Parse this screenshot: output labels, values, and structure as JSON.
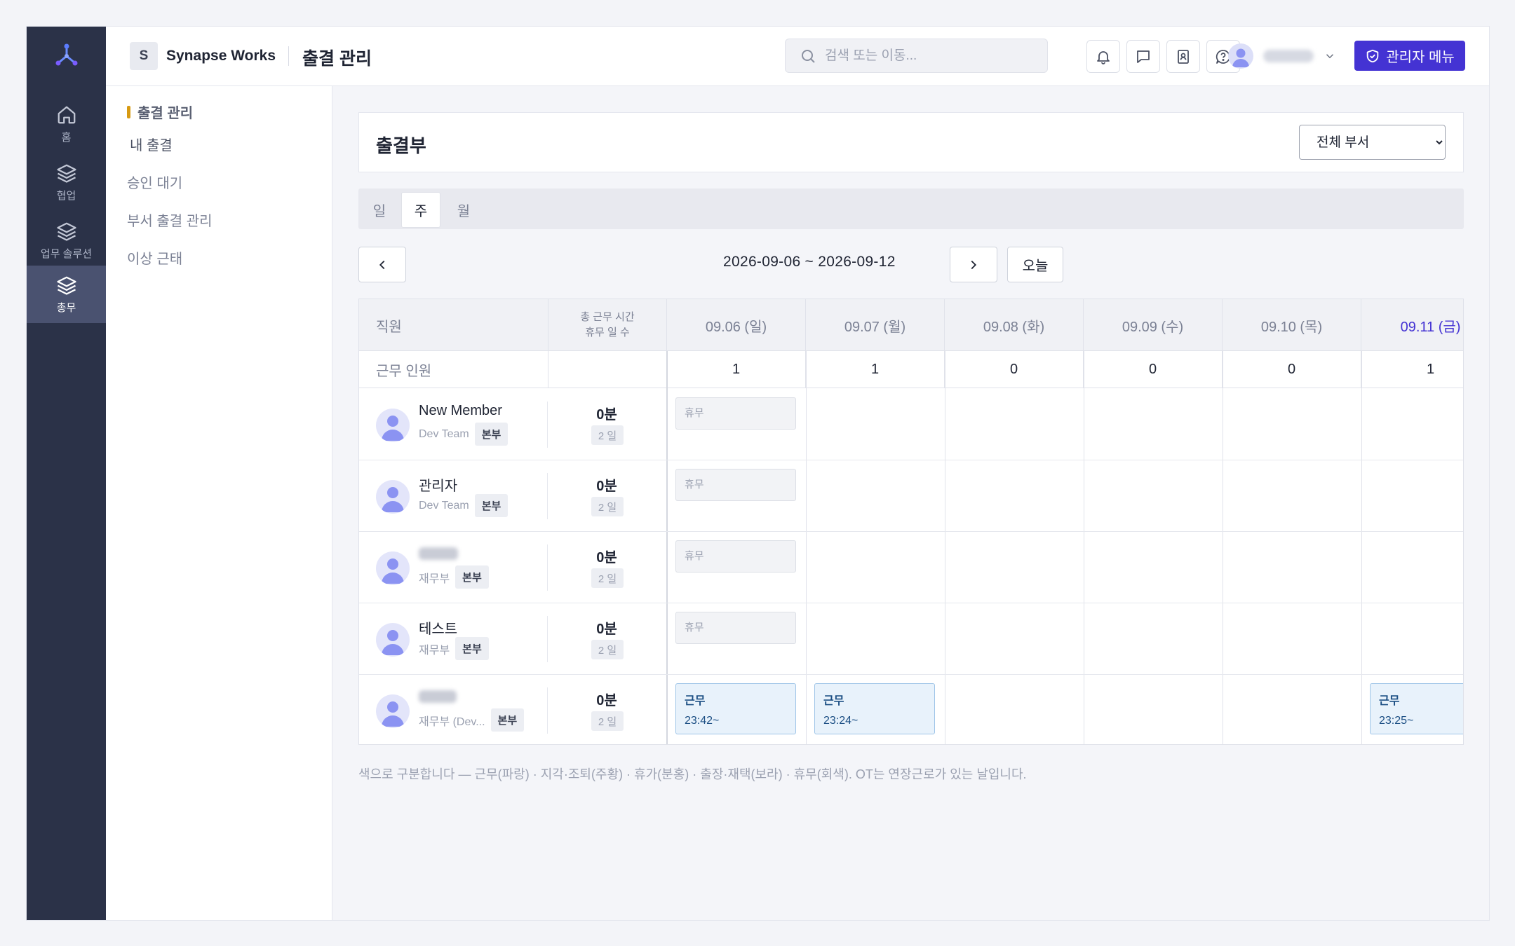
{
  "rail": {
    "items": [
      {
        "label": "홈",
        "icon": "home-icon"
      },
      {
        "label": "협업",
        "icon": "layers-icon"
      },
      {
        "label": "업무 솔루션",
        "icon": "layers-icon"
      },
      {
        "label": "총무",
        "icon": "layers-icon",
        "active": true
      }
    ]
  },
  "topbar": {
    "brand_initial": "S",
    "brand_name": "Synapse Works",
    "page_title": "출결 관리",
    "search_placeholder": "검색 또는 이동...",
    "admin_label": "관리자 메뉴",
    "icons": [
      "bell-icon",
      "chat-icon",
      "contacts-icon",
      "help-icon"
    ]
  },
  "subnav": {
    "heading": "출결 관리",
    "items": [
      "내 출결",
      "승인 대기",
      "부서 출결 관리",
      "이상 근태"
    ]
  },
  "main": {
    "card_title": "출결부",
    "dept_select": {
      "value": "전체 부서",
      "options": [
        "전체 부서"
      ]
    },
    "tabs": [
      {
        "label": "일"
      },
      {
        "label": "주",
        "active": true
      },
      {
        "label": "월"
      }
    ],
    "date_range": "2026-09-06 ~ 2026-09-12",
    "today_label": "오늘",
    "legend": "색으로 구분합니다 — 근무(파랑) · 지각·조퇴(주황) · 휴가(분홍) · 출장·재택(보라) · 휴무(회색). OT는 연장근로가 있는 날입니다."
  },
  "grid": {
    "header": {
      "employee": "직원",
      "total_line1": "총 근무 시간",
      "total_line2": "휴무 일 수",
      "days": [
        "09.06 (일)",
        "09.07 (월)",
        "09.08 (화)",
        "09.09 (수)",
        "09.10 (목)",
        "09.11 (금)"
      ]
    },
    "count_row": {
      "label": "근무 인원",
      "values": [
        "1",
        "1",
        "0",
        "0",
        "0",
        "1"
      ]
    },
    "rows": [
      {
        "name": "New Member",
        "dept": "Dev Team",
        "tag": "본부",
        "total": "0분",
        "days_off": "2 일",
        "cells": [
          {
            "type": "rest",
            "label": "휴무"
          },
          null,
          null,
          null,
          null,
          null
        ]
      },
      {
        "name": "관리자",
        "dept": "Dev Team",
        "tag": "본부",
        "total": "0분",
        "days_off": "2 일",
        "cells": [
          {
            "type": "rest",
            "label": "휴무"
          },
          null,
          null,
          null,
          null,
          null
        ]
      },
      {
        "name": "",
        "dept": "재무부",
        "tag": "본부",
        "total": "0분",
        "days_off": "2 일",
        "cells": [
          {
            "type": "rest",
            "label": "휴무"
          },
          null,
          null,
          null,
          null,
          null
        ]
      },
      {
        "name": "테스트",
        "dept": "재무부",
        "tag": "본부",
        "total": "0분",
        "days_off": "2 일",
        "cells": [
          {
            "type": "rest",
            "label": "휴무"
          },
          null,
          null,
          null,
          null,
          null
        ]
      },
      {
        "name": "",
        "dept": "재무부 (Dev...",
        "tag": "본부",
        "total": "0분",
        "days_off": "2 일",
        "cells": [
          {
            "type": "work",
            "label": "근무",
            "time": "23:42~"
          },
          {
            "type": "work",
            "label": "근무",
            "time": "23:24~"
          },
          null,
          null,
          null,
          {
            "type": "work",
            "label": "근무",
            "time": "23:25~"
          }
        ]
      }
    ]
  },
  "colors": {
    "rail_bg": "#2b3248",
    "accent": "#4433d3",
    "subnav_marker": "#d79a12",
    "work_chip_bg": "#e8f2fb",
    "work_chip_border": "#9fc5e8",
    "rest_chip_bg": "#f2f3f6"
  }
}
